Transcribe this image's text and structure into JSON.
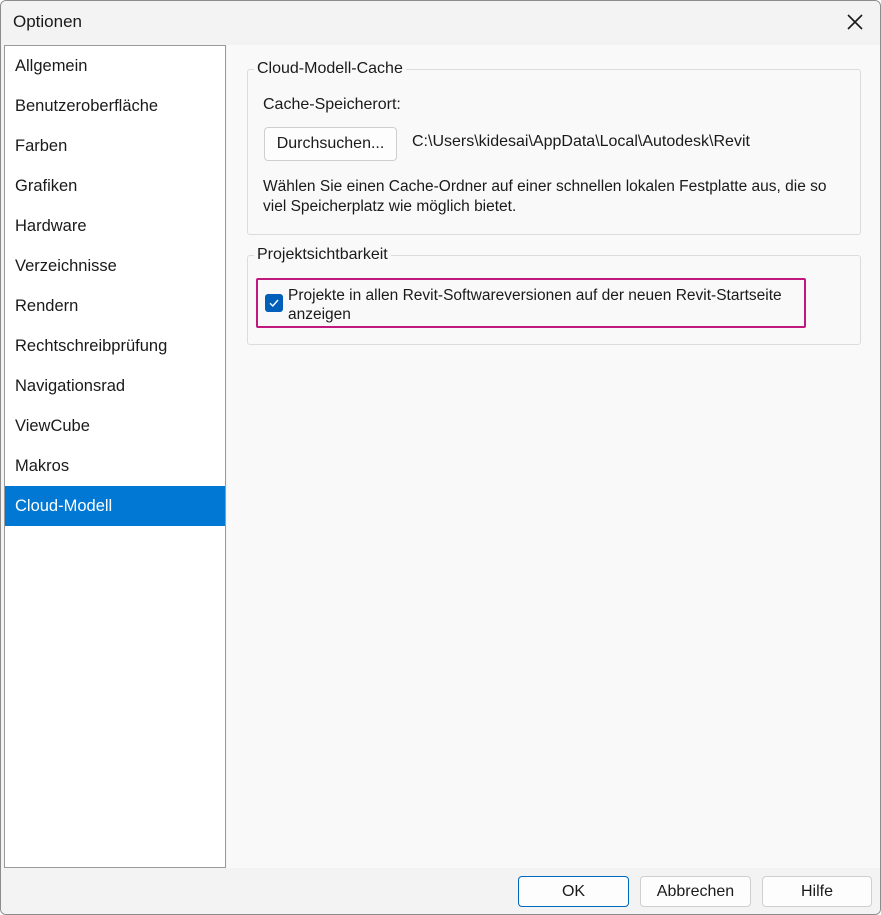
{
  "window": {
    "title": "Optionen"
  },
  "nav": {
    "items": [
      {
        "label": "Allgemein"
      },
      {
        "label": "Benutzeroberfläche"
      },
      {
        "label": "Farben"
      },
      {
        "label": "Grafiken"
      },
      {
        "label": "Hardware"
      },
      {
        "label": "Verzeichnisse"
      },
      {
        "label": "Rendern"
      },
      {
        "label": "Rechtschreibprüfung"
      },
      {
        "label": "Navigationsrad"
      },
      {
        "label": "ViewCube"
      },
      {
        "label": "Makros"
      },
      {
        "label": "Cloud-Modell"
      }
    ],
    "selected": "Cloud-Modell"
  },
  "cache": {
    "title": "Cloud-Modell-Cache",
    "location_label": "Cache-Speicherort:",
    "browse_label": "Durchsuchen...",
    "path": "C:\\Users\\kidesai\\AppData\\Local\\Autodesk\\Revit",
    "description": "Wählen Sie einen Cache-Ordner auf einer schnellen lokalen Festplatte aus, die so viel Speicherplatz wie möglich bietet."
  },
  "visibility": {
    "title": "Projektsichtbarkeit",
    "checkbox_label": "Projekte in allen Revit-Softwareversionen auf der neuen Revit-Startseite anzeigen",
    "checked": true
  },
  "footer": {
    "ok_label": "OK",
    "cancel_label": "Abbrechen",
    "help_label": "Hilfe"
  },
  "colors": {
    "accent": "#0078d4",
    "highlight_border": "#c0187e"
  },
  "icons": {
    "close": "close-icon",
    "check": "checkmark-icon"
  }
}
